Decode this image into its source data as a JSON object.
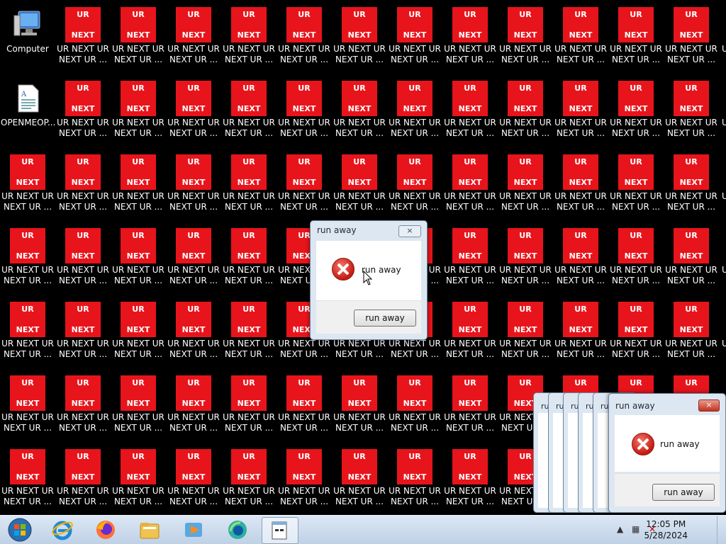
{
  "desktop": {
    "computer_label": "Computer",
    "doc_label": "OPENMEOP...",
    "tile_top": "UR",
    "tile_bottom": "NEXT",
    "item_label": "UR NEXT UR\nNEXT UR ...",
    "edge_label": "U"
  },
  "dialog_main": {
    "title": "run away",
    "close_label": "×",
    "message": "run away",
    "button_label": "run away"
  },
  "dialog_bottom": {
    "title": "run away",
    "close_label": "×",
    "message": "run away",
    "button_label": "run away"
  },
  "ghost_dialogs": {
    "title_fragment": "ru"
  },
  "taskbar": {
    "time": "12:05 PM",
    "date": "5/28/2024",
    "icons": [
      "start-orb-icon",
      "internet-explorer-icon",
      "firefox-icon",
      "file-explorer-icon",
      "media-player-icon",
      "edge-icon",
      "notepad-document-icon"
    ]
  },
  "colors": {
    "tile_red": "#e8141b",
    "desktop_bg": "#000000",
    "taskbar": "#c8d8ea"
  }
}
